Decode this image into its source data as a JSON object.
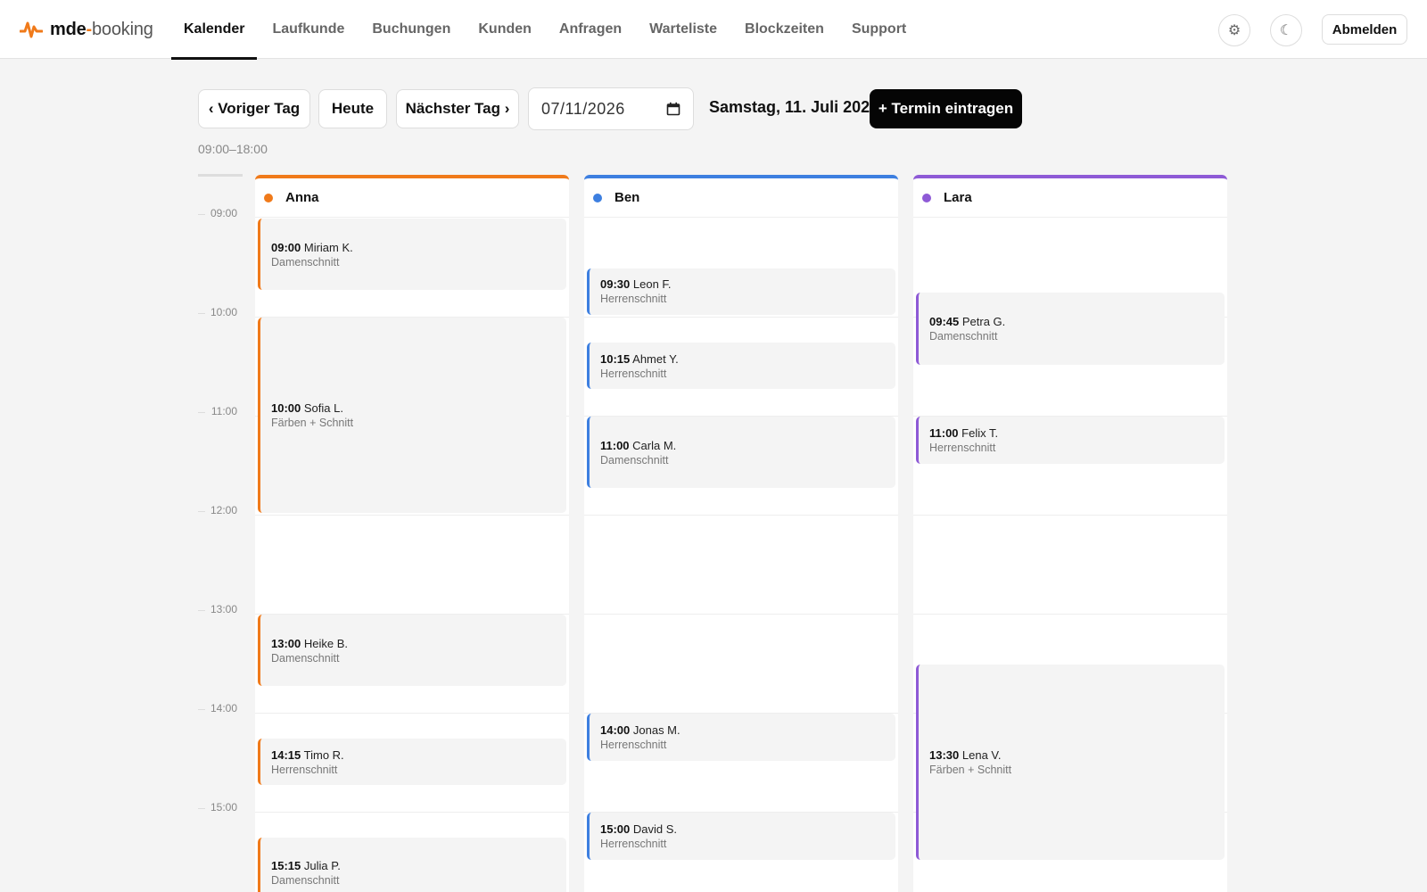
{
  "brand": {
    "part1": "mde",
    "part2": "-",
    "part3": "booking",
    "accent": "#f07a1a"
  },
  "nav": [
    {
      "label": "Kalender",
      "active": true
    },
    {
      "label": "Laufkunde"
    },
    {
      "label": "Buchungen"
    },
    {
      "label": "Kunden"
    },
    {
      "label": "Anfragen"
    },
    {
      "label": "Warteliste"
    },
    {
      "label": "Blockzeiten"
    },
    {
      "label": "Support"
    }
  ],
  "header": {
    "settings_icon": "⚙",
    "theme_icon": "☾",
    "logout_label": "Abmelden"
  },
  "toolbar": {
    "prev_label": "‹ Voriger Tag",
    "today_label": "Heute",
    "next_label": "Nächster Tag ›",
    "date_value": "07/11/2026",
    "date_title": "Samstag, 11. Juli 2026",
    "add_label": "+ Termin eintragen",
    "range": "09:00–18:00"
  },
  "times": [
    "09:00",
    "10:00",
    "11:00",
    "12:00",
    "13:00",
    "14:00",
    "15:00"
  ],
  "staff": [
    {
      "name": "Anna",
      "color": "#f07a1a",
      "appointments": [
        {
          "time": "09:00",
          "client": "Miriam K.",
          "service": "Damenschnitt",
          "start": "09:00",
          "end": "09:45"
        },
        {
          "time": "10:00",
          "client": "Sofia L.",
          "service": "Färben + Schnitt",
          "start": "10:00",
          "end": "12:00"
        },
        {
          "time": "13:00",
          "client": "Heike B.",
          "service": "Damenschnitt",
          "start": "13:00",
          "end": "13:45"
        },
        {
          "time": "14:15",
          "client": "Timo R.",
          "service": "Herrenschnitt",
          "start": "14:15",
          "end": "14:45"
        },
        {
          "time": "15:15",
          "client": "Julia P.",
          "service": "Damenschnitt",
          "start": "15:15",
          "end": "16:00"
        }
      ]
    },
    {
      "name": "Ben",
      "color": "#3d7fe0",
      "appointments": [
        {
          "time": "09:30",
          "client": "Leon F.",
          "service": "Herrenschnitt",
          "start": "09:30",
          "end": "10:00"
        },
        {
          "time": "10:15",
          "client": "Ahmet Y.",
          "service": "Herrenschnitt",
          "start": "10:15",
          "end": "10:45"
        },
        {
          "time": "11:00",
          "client": "Carla M.",
          "service": "Damenschnitt",
          "start": "11:00",
          "end": "11:45"
        },
        {
          "time": "14:00",
          "client": "Jonas M.",
          "service": "Herrenschnitt",
          "start": "14:00",
          "end": "14:30"
        },
        {
          "time": "15:00",
          "client": "David S.",
          "service": "Herrenschnitt",
          "start": "15:00",
          "end": "15:30"
        }
      ]
    },
    {
      "name": "Lara",
      "color": "#8e5ad6",
      "appointments": [
        {
          "time": "09:45",
          "client": "Petra G.",
          "service": "Damenschnitt",
          "start": "09:45",
          "end": "10:30"
        },
        {
          "time": "11:00",
          "client": "Felix T.",
          "service": "Herrenschnitt",
          "start": "11:00",
          "end": "11:30"
        },
        {
          "time": "13:30",
          "client": "Lena V.",
          "service": "Färben + Schnitt",
          "start": "13:30",
          "end": "15:30"
        }
      ]
    }
  ]
}
